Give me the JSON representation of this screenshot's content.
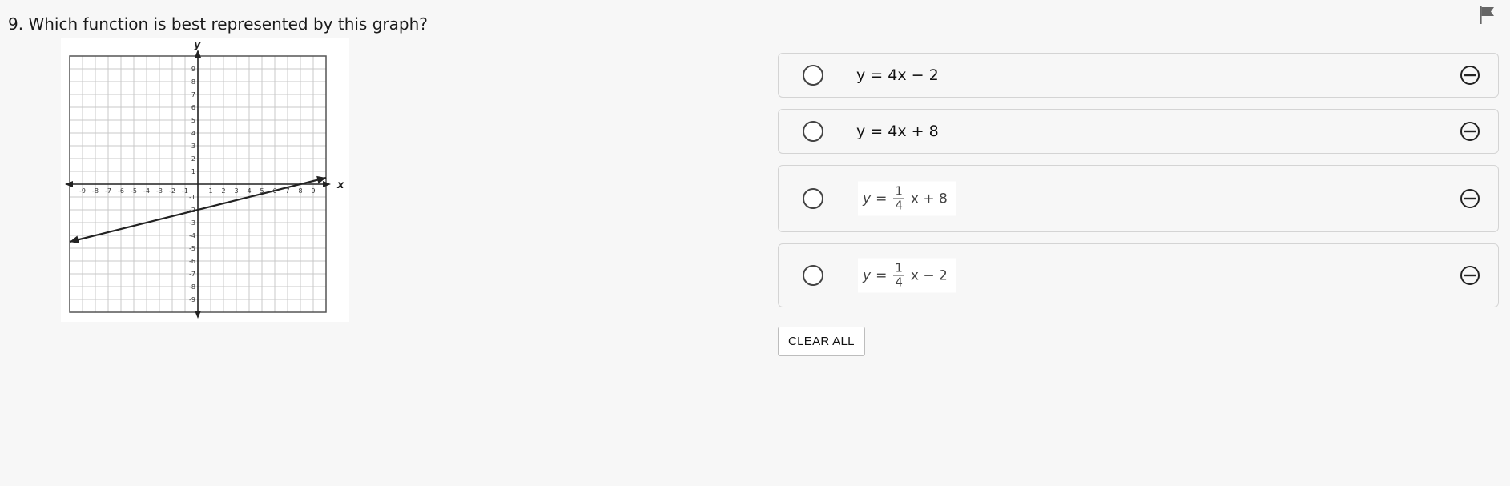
{
  "question": {
    "number": "9.",
    "text": "Which function is best represented by this graph?"
  },
  "graph": {
    "x_axis_label": "x",
    "y_axis_label": "y",
    "x_ticks": [
      "-9",
      "-8",
      "-7",
      "-6",
      "-5",
      "-4",
      "-3",
      "-2",
      "-1",
      "1",
      "2",
      "3",
      "4",
      "5",
      "6",
      "7",
      "8",
      "9"
    ],
    "y_ticks": [
      "9",
      "8",
      "7",
      "6",
      "5",
      "4",
      "3",
      "2",
      "1",
      "-1",
      "-2",
      "-3",
      "-4",
      "-5",
      "-6",
      "-7",
      "-8",
      "-9"
    ],
    "x_range": [
      -10,
      10
    ],
    "y_range": [
      -10,
      10
    ],
    "line": {
      "x1": -10,
      "y1": -4.5,
      "x2": 10,
      "y2": 0.5
    },
    "grid": true
  },
  "options": [
    {
      "id": "A",
      "text": "y = 4x − 2"
    },
    {
      "id": "B",
      "text": "y = 4x + 8"
    },
    {
      "id": "C",
      "lhs": "y",
      "equals": "=",
      "numerator": "1",
      "denominator": "4",
      "rest": "x + 8"
    },
    {
      "id": "D",
      "lhs": "y",
      "equals": "=",
      "numerator": "1",
      "denominator": "4",
      "rest": "x − 2"
    }
  ],
  "clear_all_label": "CLEAR ALL",
  "icons": {
    "flag": "flag-icon",
    "radio": "radio-button-icon",
    "eliminate": "eliminate-icon"
  }
}
